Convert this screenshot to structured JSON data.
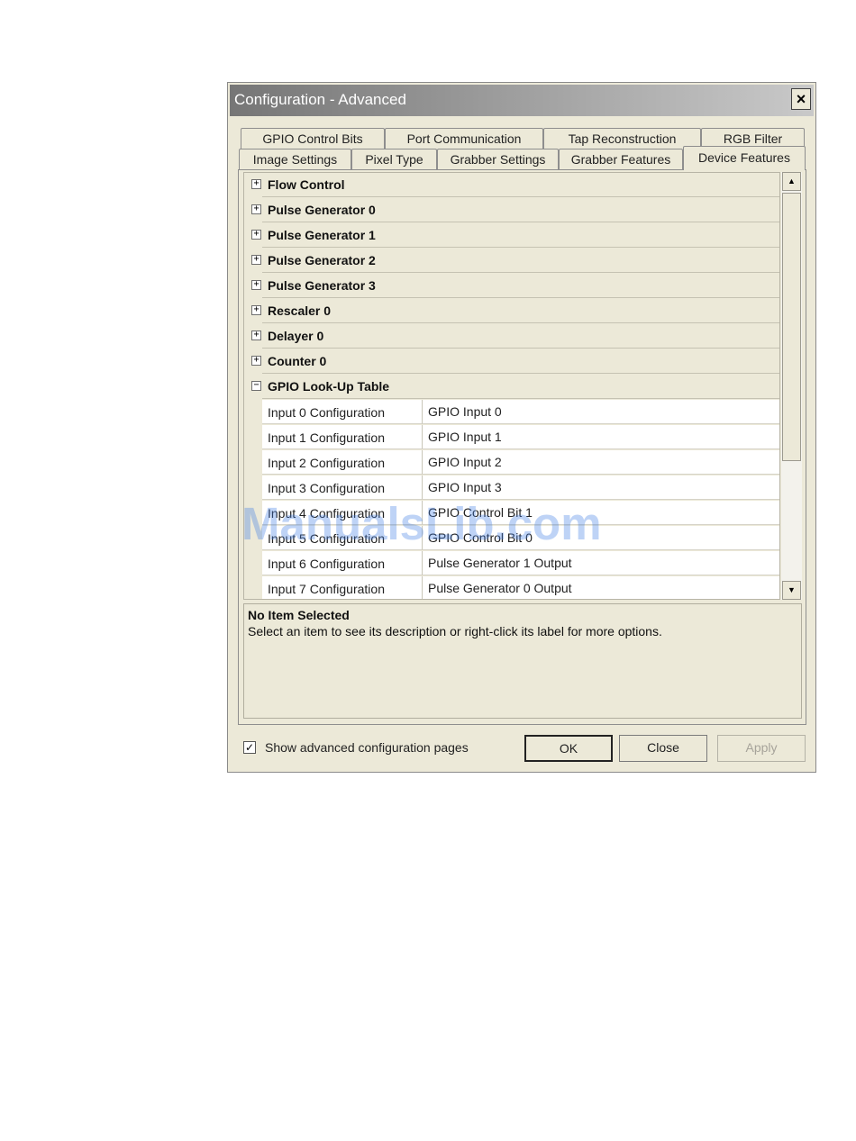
{
  "window": {
    "title": "Configuration - Advanced",
    "close_symbol": "×"
  },
  "tabs": {
    "back_row": [
      "GPIO Control Bits",
      "Port Communication",
      "Tap Reconstruction",
      "RGB Filter"
    ],
    "front_row": [
      "Image Settings",
      "Pixel Type",
      "Grabber Settings",
      "Grabber Features",
      "Device Features"
    ],
    "active": "Device Features"
  },
  "grid": {
    "categories": [
      {
        "label": "Flow Control",
        "expander": "+"
      },
      {
        "label": "Pulse Generator 0",
        "expander": "+"
      },
      {
        "label": "Pulse Generator 1",
        "expander": "+"
      },
      {
        "label": "Pulse Generator 2",
        "expander": "+"
      },
      {
        "label": "Pulse Generator 3",
        "expander": "+"
      },
      {
        "label": "Rescaler 0",
        "expander": "+"
      },
      {
        "label": "Delayer 0",
        "expander": "+"
      },
      {
        "label": "Counter 0",
        "expander": "+"
      },
      {
        "label": "GPIO Look-Up Table",
        "expander": "−"
      }
    ],
    "properties": [
      {
        "name": "Input 0 Configuration",
        "value": "GPIO Input 0"
      },
      {
        "name": "Input 1 Configuration",
        "value": "GPIO Input 1"
      },
      {
        "name": "Input 2 Configuration",
        "value": "GPIO Input 2"
      },
      {
        "name": "Input 3 Configuration",
        "value": "GPIO Input 3"
      },
      {
        "name": "Input 4 Configuration",
        "value": "GPIO Control Bit 1"
      },
      {
        "name": "Input 5 Configuration",
        "value": "GPIO Control Bit 0"
      },
      {
        "name": "Input 6 Configuration",
        "value": "Pulse Generator 1 Output"
      },
      {
        "name": "Input 7 Configuration",
        "value": "Pulse Generator 0 Output"
      }
    ],
    "scroll_up": "▲",
    "scroll_down": "▼"
  },
  "description": {
    "title": "No Item Selected",
    "text": "Select an item to see its description or right-click its label for more options."
  },
  "footer": {
    "checkbox_label": "Show advanced configuration pages",
    "checkbox_mark": "✓",
    "ok_label": "OK",
    "close_label": "Close",
    "apply_label": "Apply"
  },
  "watermark": "ManualsLib.com",
  "icons": {
    "expand": "plus-box-icon",
    "collapse": "minus-box-icon",
    "close": "close-icon"
  }
}
